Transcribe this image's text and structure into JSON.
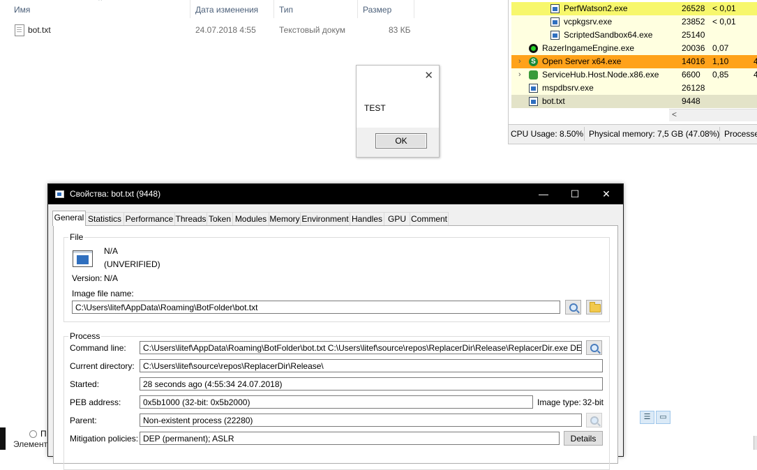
{
  "explorer": {
    "columns": [
      "Имя",
      "Дата изменения",
      "Тип",
      "Размер"
    ],
    "file": {
      "name": "bot.txt",
      "date": "24.07.2018 4:55",
      "type": "Текстовый докум",
      "size": "83 КБ"
    },
    "bottom_left": {
      "item1": "П",
      "item2": "Элемент"
    }
  },
  "msgbox": {
    "text": "TEST",
    "ok_label": "OK",
    "close_glyph": "✕"
  },
  "process_list": {
    "rows": [
      {
        "name": "PerfWatson2.exe",
        "pid": "26528",
        "cpu": "< 0,01",
        "icon": "window-icon",
        "indent": 3,
        "bg": "#f7f76c"
      },
      {
        "name": "vcpkgsrv.exe",
        "pid": "23852",
        "cpu": "< 0,01",
        "icon": "window-icon",
        "indent": 3,
        "bg": "#ffffe0"
      },
      {
        "name": "ScriptedSandbox64.exe",
        "pid": "25140",
        "cpu": "",
        "icon": "window-icon",
        "indent": 3,
        "bg": "#ffffe0"
      },
      {
        "name": "RazerIngameEngine.exe",
        "pid": "20036",
        "cpu": "0,07",
        "icon": "razer-icon",
        "indent": 2,
        "bg": "#ffffe0"
      },
      {
        "name": "Open Server x64.exe",
        "pid": "14016",
        "cpu": "1,10",
        "icon": "open-server-icon",
        "indent": 2,
        "bg": "#ffa21a",
        "chevron": "›",
        "extra": "4"
      },
      {
        "name": "ServiceHub.Host.Node.x86.exe",
        "pid": "6600",
        "cpu": "0,85",
        "icon": "servicehub-icon",
        "indent": 2,
        "bg": "#ffffe0",
        "chevron": "›",
        "extra": "4"
      },
      {
        "name": "mspdbsrv.exe",
        "pid": "26128",
        "cpu": "",
        "icon": "window-icon",
        "indent": 2,
        "bg": "#ffffe0"
      },
      {
        "name": "bot.txt",
        "pid": "9448",
        "cpu": "",
        "icon": "window-icon",
        "indent": 2,
        "bg": "#e3e3c8"
      }
    ],
    "scroll_left_glyph": "<",
    "status": {
      "cpu": "CPU Usage: 8.50%",
      "memory": "Physical memory: 7,5 GB (47.08%)",
      "processes": "Processes"
    }
  },
  "props": {
    "title": "Свойства: bot.txt (9448)",
    "window_buttons": {
      "minimize": "—",
      "maximize": "☐",
      "close": "✕"
    },
    "tabs": [
      "General",
      "Statistics",
      "Performance",
      "Threads",
      "Token",
      "Modules",
      "Memory",
      "Environment",
      "Handles",
      "GPU",
      "Comment"
    ],
    "active_tab": "General",
    "file": {
      "group_label": "File",
      "company": "N/A",
      "verified": "(UNVERIFIED)",
      "version_label": "Version:",
      "version": "N/A",
      "image_label": "Image file name:",
      "image_path": "C:\\Users\\litef\\AppData\\Roaming\\BotFolder\\bot.txt"
    },
    "process": {
      "group_label": "Process",
      "command_label": "Command line:",
      "command": "C:\\Users\\litef\\AppData\\Roaming\\BotFolder\\bot.txt C:\\Users\\litef\\source\\repos\\ReplacerDir\\Release\\ReplacerDir.exe DEL_ME",
      "curdir_label": "Current directory:",
      "curdir": "C:\\Users\\litef\\source\\repos\\ReplacerDir\\Release\\",
      "started_label": "Started:",
      "started": "28 seconds ago (4:55:34 24.07.2018)",
      "peb_label": "PEB address:",
      "peb": "0x5b1000 (32-bit: 0x5b2000)",
      "image_type_label": "Image type:",
      "image_type": "32-bit",
      "parent_label": "Parent:",
      "parent": "Non-existent process (22280)",
      "mitigation_label": "Mitigation policies:",
      "mitigation": "DEP (permanent); ASLR",
      "details_label": "Details"
    }
  }
}
